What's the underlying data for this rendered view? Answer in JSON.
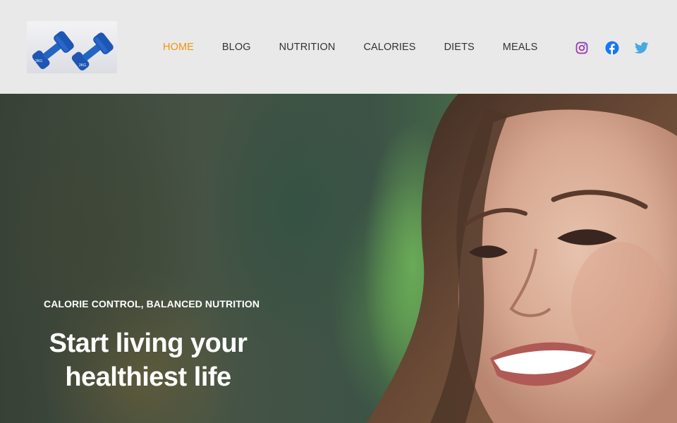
{
  "brand": {
    "logo_icon": "dumbbells-logo",
    "logo_mark_text": "2KG"
  },
  "nav": {
    "items": [
      {
        "label": "HOME",
        "active": true
      },
      {
        "label": "BLOG",
        "active": false
      },
      {
        "label": "NUTRITION",
        "active": false
      },
      {
        "label": "CALORIES",
        "active": false
      },
      {
        "label": "DIETS",
        "active": false
      },
      {
        "label": "MEALS",
        "active": false
      }
    ]
  },
  "social": {
    "icons": [
      "instagram-icon",
      "facebook-icon",
      "twitter-icon"
    ],
    "colors": {
      "instagram": "#9b3bb5",
      "facebook": "#1877f2",
      "twitter": "#4aa8e0"
    }
  },
  "hero": {
    "tagline": "CALORIE CONTROL, BALANCED NUTRITION",
    "headline": "Start living your healthiest life",
    "image": "smiling-woman-photo"
  },
  "colors": {
    "accent": "#f0960a",
    "nav_text": "#333333",
    "header_bg": "#e9e9e9",
    "hero_text": "#ffffff"
  }
}
